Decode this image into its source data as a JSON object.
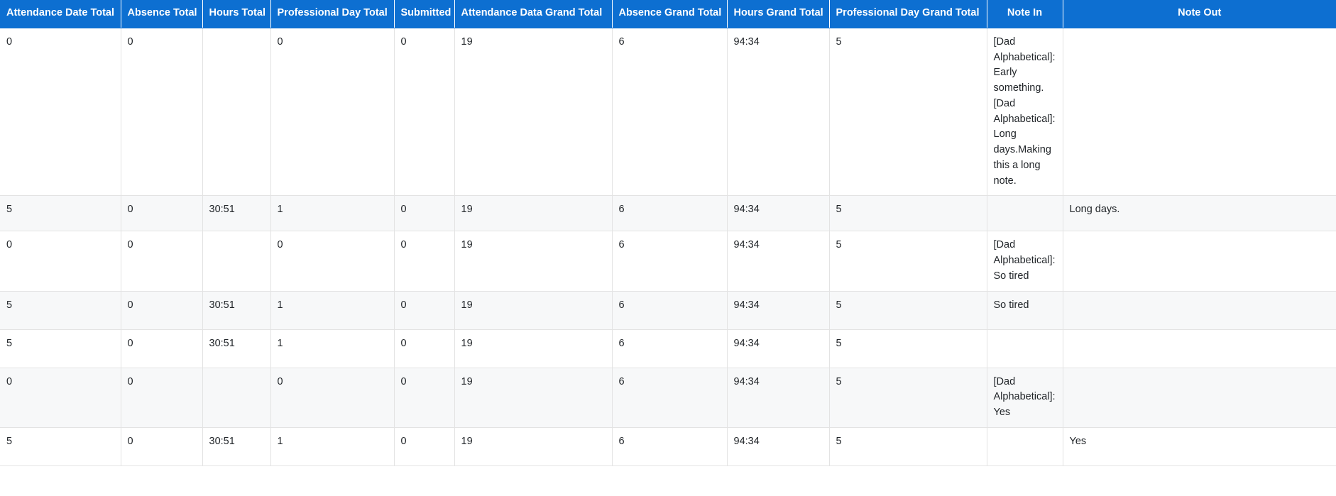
{
  "table": {
    "columns": [
      {
        "key": "attendance_date_total",
        "label": "Attendance Date Total",
        "align": "left"
      },
      {
        "key": "absence_total",
        "label": "Absence Total",
        "align": "left"
      },
      {
        "key": "hours_total",
        "label": "Hours Total",
        "align": "left"
      },
      {
        "key": "professional_day_total",
        "label": "Professional Day Total",
        "align": "left"
      },
      {
        "key": "submitted",
        "label": "Submitted",
        "align": "left"
      },
      {
        "key": "attendance_data_grand_total",
        "label": "Attendance Data Grand Total",
        "align": "left"
      },
      {
        "key": "absence_grand_total",
        "label": "Absence Grand Total",
        "align": "left"
      },
      {
        "key": "hours_grand_total",
        "label": "Hours Grand Total",
        "align": "left"
      },
      {
        "key": "professional_day_grand_total",
        "label": "Professional Day Grand Total",
        "align": "left"
      },
      {
        "key": "note_in",
        "label": "Note In",
        "align": "center"
      },
      {
        "key": "note_out",
        "label": "Note Out",
        "align": "center"
      }
    ],
    "rows": [
      {
        "attendance_date_total": "0",
        "absence_total": "0",
        "hours_total": "",
        "professional_day_total": "0",
        "submitted": "0",
        "attendance_data_grand_total": "19",
        "absence_grand_total": "6",
        "hours_grand_total": "94:34",
        "professional_day_grand_total": "5",
        "note_in": "[Dad Alphabetical]: Early something.[Dad Alphabetical]: Long days.Making this a long note.",
        "note_out": ""
      },
      {
        "attendance_date_total": "5",
        "absence_total": "0",
        "hours_total": "30:51",
        "professional_day_total": "1",
        "submitted": "0",
        "attendance_data_grand_total": "19",
        "absence_grand_total": "6",
        "hours_grand_total": "94:34",
        "professional_day_grand_total": "5",
        "note_in": "",
        "note_out": "Long days."
      },
      {
        "attendance_date_total": "0",
        "absence_total": "0",
        "hours_total": "",
        "professional_day_total": "0",
        "submitted": "0",
        "attendance_data_grand_total": "19",
        "absence_grand_total": "6",
        "hours_grand_total": "94:34",
        "professional_day_grand_total": "5",
        "note_in": "[Dad Alphabetical]: So tired",
        "note_out": ""
      },
      {
        "attendance_date_total": "5",
        "absence_total": "0",
        "hours_total": "30:51",
        "professional_day_total": "1",
        "submitted": "0",
        "attendance_data_grand_total": "19",
        "absence_grand_total": "6",
        "hours_grand_total": "94:34",
        "professional_day_grand_total": "5",
        "note_in": "So tired",
        "note_out": ""
      },
      {
        "attendance_date_total": "5",
        "absence_total": "0",
        "hours_total": "30:51",
        "professional_day_total": "1",
        "submitted": "0",
        "attendance_data_grand_total": "19",
        "absence_grand_total": "6",
        "hours_grand_total": "94:34",
        "professional_day_grand_total": "5",
        "note_in": "",
        "note_out": ""
      },
      {
        "attendance_date_total": "0",
        "absence_total": "0",
        "hours_total": "",
        "professional_day_total": "0",
        "submitted": "0",
        "attendance_data_grand_total": "19",
        "absence_grand_total": "6",
        "hours_grand_total": "94:34",
        "professional_day_grand_total": "5",
        "note_in": "[Dad Alphabetical]: Yes",
        "note_out": ""
      },
      {
        "attendance_date_total": "5",
        "absence_total": "0",
        "hours_total": "30:51",
        "professional_day_total": "1",
        "submitted": "0",
        "attendance_data_grand_total": "19",
        "absence_grand_total": "6",
        "hours_grand_total": "94:34",
        "professional_day_grand_total": "5",
        "note_in": "",
        "note_out": "Yes"
      }
    ],
    "row_min_heights": [
      222,
      50,
      76,
      54,
      54,
      76,
      54
    ],
    "colors": {
      "header_background": "#0d6fd1",
      "header_text": "#ffffff",
      "row_odd_background": "#ffffff",
      "row_even_background": "#f7f8f9",
      "cell_text": "#212529",
      "border": "#e3e3e3"
    }
  }
}
